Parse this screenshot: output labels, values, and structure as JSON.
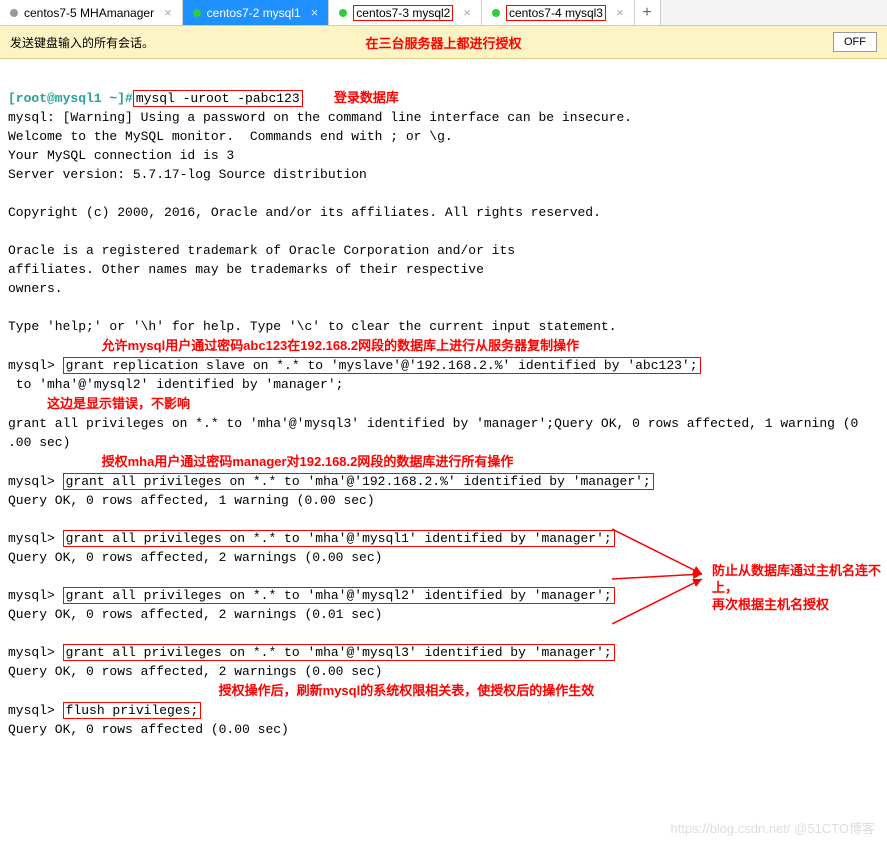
{
  "tabs": [
    {
      "label": "centos7-5 MHAmanager",
      "active": false,
      "dot": "grey"
    },
    {
      "label": "centos7-2 mysql1",
      "active": true,
      "dot": "green"
    },
    {
      "label": "centos7-3 mysql2",
      "active": false,
      "dot": "green",
      "boxed": true
    },
    {
      "label": "centos7-4 mysql3",
      "active": false,
      "dot": "green",
      "boxed": true
    }
  ],
  "infobar": {
    "send_text": "发送键盘输入的所有会话。",
    "note": "在三台服务器上都进行授权",
    "off": "OFF"
  },
  "term": {
    "prompt": "[root@mysql1 ~]#",
    "login_cmd": "mysql -uroot -pabc123",
    "login_annot": "登录数据库",
    "block1_l1": "mysql: [Warning] Using a password on the command line interface can be insecure.",
    "block1_l2": "Welcome to the MySQL monitor.  Commands end with ; or \\g.",
    "block1_l3": "Your MySQL connection id is 3",
    "block1_l4": "Server version: 5.7.17-log Source distribution",
    "block1_l5": "",
    "block1_l6": "Copyright (c) 2000, 2016, Oracle and/or its affiliates. All rights reserved.",
    "block1_l7": "",
    "block1_l8": "Oracle is a registered trademark of Oracle Corporation and/or its",
    "block1_l9": "affiliates. Other names may be trademarks of their respective",
    "block1_l10": "owners.",
    "block1_l11": "",
    "block1_l12": "Type 'help;' or '\\h' for help. Type '\\c' to clear the current input statement.",
    "annot_repl": "允许mysql用户通过密码abc123在192.168.2网段的数据库上进行从服务器复制操作",
    "mysql_prompt": "mysql>",
    "grant_repl": "grant replication slave on *.* to 'myslave'@'192.168.2.%' identified by 'abc123';",
    "stray_line": " to 'mha'@'mysql2' identified by 'manager';",
    "annot_err": "这边是显示错误，不影响",
    "grant_trail": "grant all privileges on *.* to 'mha'@'mysql3' identified by 'manager';Query OK, 0 rows affected, 1 warning (0",
    "grant_trail2": ".00 sec)",
    "annot_mha": "授权mha用户通过密码manager对192.168.2网段的数据库进行所有操作",
    "grant_mha_net": "grant all privileges on *.* to 'mha'@'192.168.2.%' identified by 'manager';",
    "qok_1w": "Query OK, 0 rows affected, 1 warning (0.00 sec)",
    "grant_m1": "grant all privileges on *.* to 'mha'@'mysql1' identified by 'manager';",
    "qok_2w_00": "Query OK, 0 rows affected, 2 warnings (0.00 sec)",
    "grant_m2": "grant all privileges on *.* to 'mha'@'mysql2' identified by 'manager';",
    "qok_2w_01": "Query OK, 0 rows affected, 2 warnings (0.01 sec)",
    "grant_m3": "grant all privileges on *.* to 'mha'@'mysql3' identified by 'manager';",
    "annot_hostname1": "防止从数据库通过主机名连不上，",
    "annot_hostname2": "再次根据主机名授权",
    "annot_flush": "授权操作后，刷新mysql的系统权限相关表，使授权后的操作生效",
    "flush": "flush privileges;",
    "qok_0w": "Query OK, 0 rows affected (0.00 sec)",
    "watermark": "https://blog.csdn.net/ @51CTO博客"
  }
}
